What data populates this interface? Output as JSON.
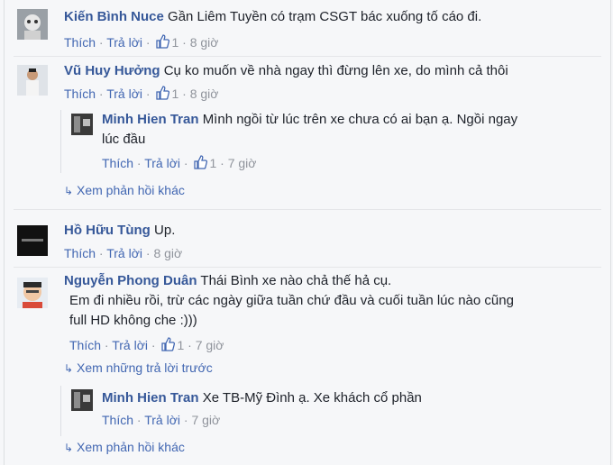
{
  "comments": [
    {
      "author": "Kiến Bình Nuce",
      "text": "Gần Liêm Tuyền có trạm CSGT bác xuống tố cáo đi.",
      "actions": {
        "like": "Thích",
        "reply": "Trả lời",
        "likes": "1",
        "time": "8 giờ"
      }
    },
    {
      "author": "Vũ Huy Hưởng",
      "text": "Cụ ko muốn về nhà ngay thì đừng lên xe, do mình cả thôi",
      "actions": {
        "like": "Thích",
        "reply": "Trả lời",
        "likes": "1",
        "time": "8 giờ"
      },
      "reply": {
        "author": "Minh Hien Tran",
        "text_line1": "Mình ngồi từ lúc trên xe chưa có ai bạn ạ. Ngồi ngay",
        "text_line2": "lúc đầu",
        "actions": {
          "like": "Thích",
          "reply": "Trả lời",
          "likes": "1",
          "time": "7 giờ"
        }
      },
      "more_replies": "Xem phản hồi khác"
    },
    {
      "author": "Hồ Hữu Tùng",
      "text": "Up.",
      "actions": {
        "like": "Thích",
        "reply": "Trả lời",
        "time": "8 giờ"
      }
    },
    {
      "author": "Nguyễn Phong Duân",
      "text_line1": "Thái Bình xe nào chả thế hả cụ.",
      "text_line2": "Em đi nhiều rồi, trừ các ngày giữa tuần chứ đầu và cuối tuần lúc nào cũng",
      "text_line3": "full HD không che :)))",
      "actions": {
        "like": "Thích",
        "reply": "Trả lời",
        "likes": "1",
        "time": "7 giờ"
      },
      "previous_replies": "Xem những trả lời trước",
      "reply": {
        "author": "Minh Hien Tran",
        "text": "Xe TB-Mỹ Đình ạ. Xe khách cổ phần",
        "actions": {
          "like": "Thích",
          "reply": "Trả lời",
          "time": "7 giờ"
        }
      },
      "more_replies": "Xem phản hồi khác"
    }
  ],
  "colors": {
    "author": "#365899",
    "link": "#4267b2",
    "meta": "#90949c",
    "text": "#1d2129"
  }
}
